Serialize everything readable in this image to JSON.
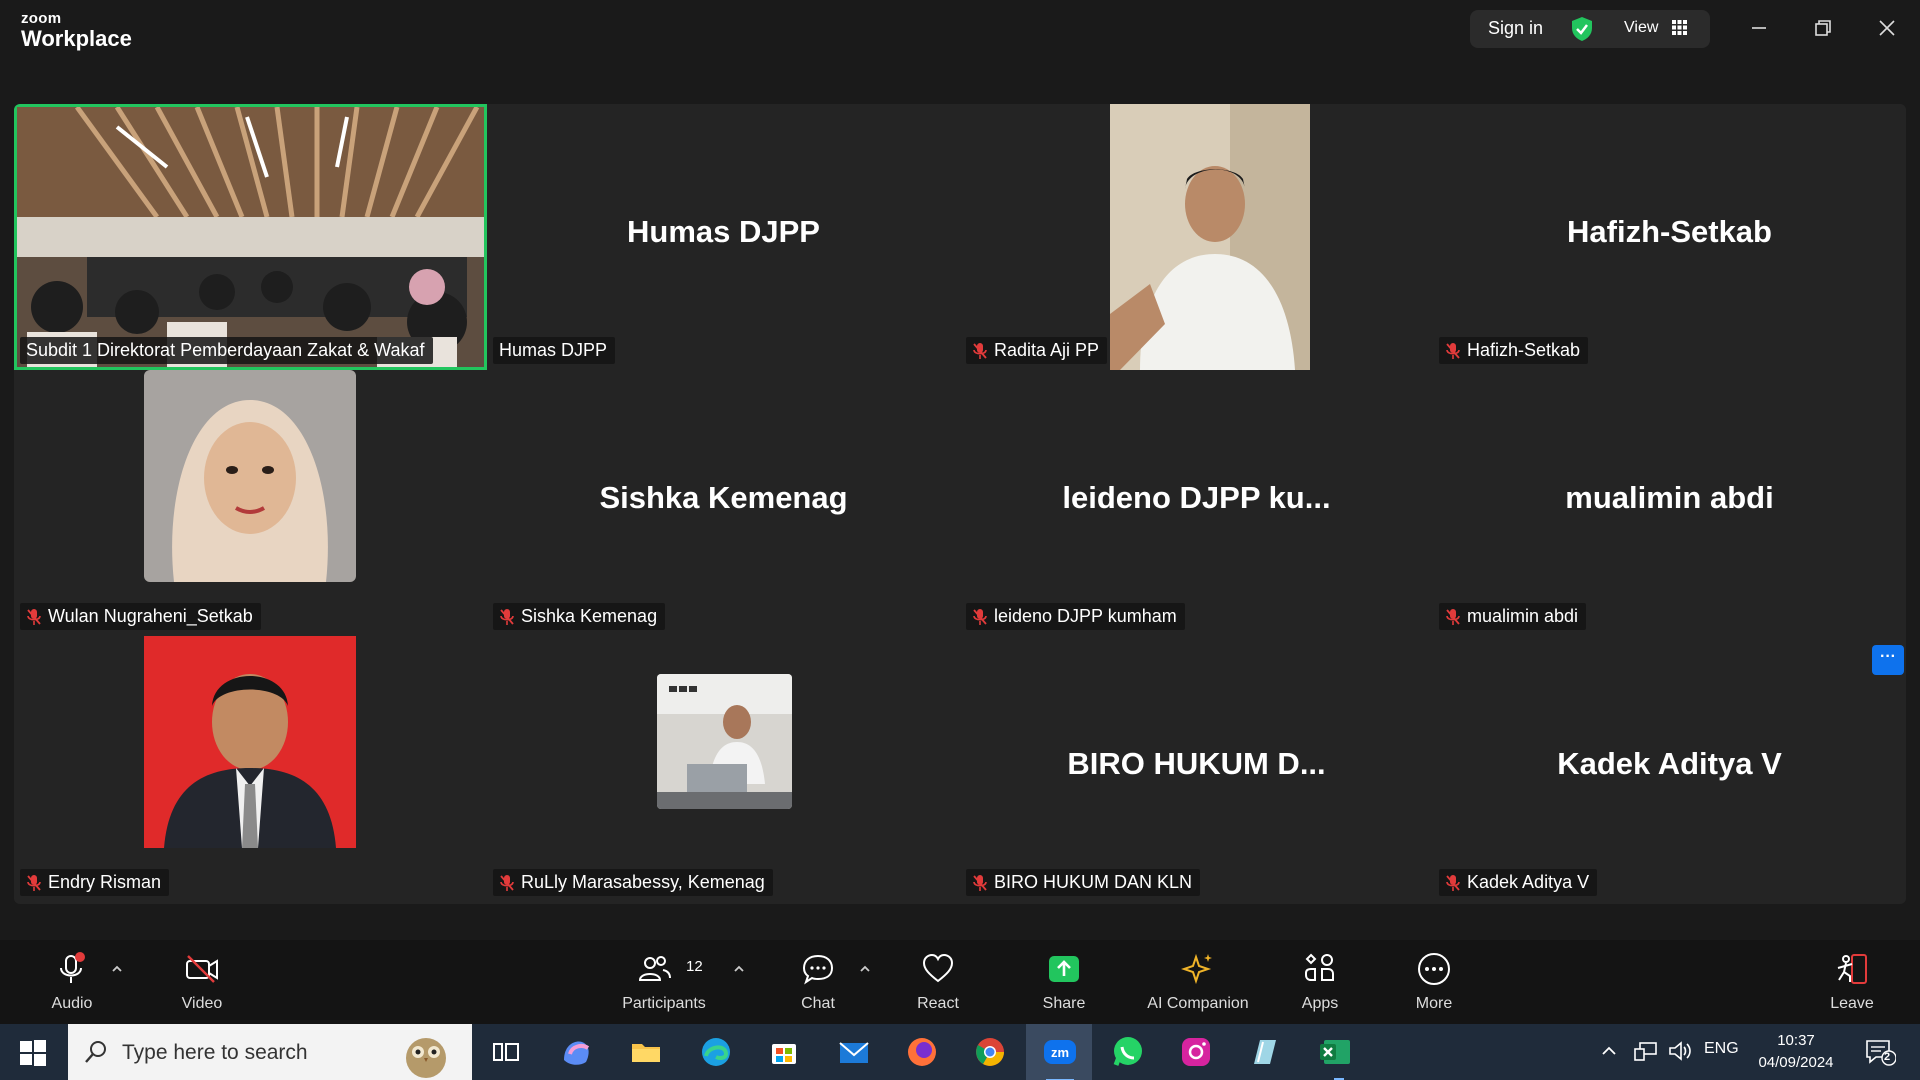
{
  "app": {
    "logo_top": "zoom",
    "logo_bottom": "Workplace"
  },
  "header": {
    "sign_in": "Sign in",
    "view": "View"
  },
  "tiles": [
    {
      "label": "Subdit 1 Direktorat Pemberdayaan Zakat & Wakaf",
      "display_name": "",
      "muted": false,
      "active": true,
      "video": "room"
    },
    {
      "label": "Humas DJPP",
      "display_name": "Humas DJPP",
      "muted": false,
      "active": false,
      "video": ""
    },
    {
      "label": "Radita Aji PP",
      "display_name": "",
      "muted": true,
      "active": false,
      "video": "man-white-shirt"
    },
    {
      "label": "Hafizh-Setkab",
      "display_name": "Hafizh-Setkab",
      "muted": true,
      "active": false,
      "video": ""
    },
    {
      "label": "Wulan Nugraheni_Setkab",
      "display_name": "",
      "muted": true,
      "active": false,
      "video": "woman-hijab"
    },
    {
      "label": "Sishka Kemenag",
      "display_name": "Sishka Kemenag",
      "muted": true,
      "active": false,
      "video": ""
    },
    {
      "label": "leideno DJPP kumham",
      "display_name": "leideno DJPP ku...",
      "muted": true,
      "active": false,
      "video": ""
    },
    {
      "label": "mualimin abdi",
      "display_name": "mualimin abdi",
      "muted": true,
      "active": false,
      "video": ""
    },
    {
      "label": "Endry Risman",
      "display_name": "",
      "muted": true,
      "active": false,
      "video": "man-red-bg"
    },
    {
      "label": "RuLly Marasabessy, Kemenag",
      "display_name": "",
      "muted": true,
      "active": false,
      "video": "man-laptop"
    },
    {
      "label": "BIRO HUKUM DAN KLN",
      "display_name": "BIRO HUKUM D...",
      "muted": true,
      "active": false,
      "video": ""
    },
    {
      "label": "Kadek Aditya V",
      "display_name": "Kadek Aditya V",
      "muted": true,
      "active": false,
      "video": ""
    }
  ],
  "toolbar": {
    "audio": "Audio",
    "video": "Video",
    "participants": "Participants",
    "participants_count": "12",
    "chat": "Chat",
    "react": "React",
    "share": "Share",
    "ai_companion": "AI Companion",
    "apps": "Apps",
    "more": "More",
    "leave": "Leave"
  },
  "taskbar": {
    "search_placeholder": "Type here to search",
    "lang": "ENG",
    "time": "10:37",
    "date": "04/09/2024",
    "notifications": "2"
  },
  "colors": {
    "active_border": "#22c55e",
    "share_green": "#22c55e",
    "accent_blue": "#0e72ed",
    "mute_red": "#e23b3b"
  }
}
